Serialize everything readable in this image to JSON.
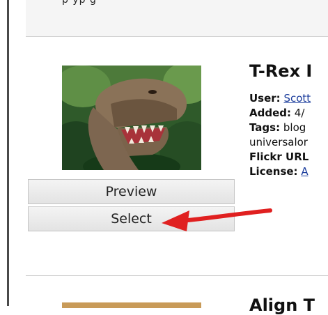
{
  "header": {
    "partial_text": "p  yp g  "
  },
  "result": {
    "title": "T-Rex I",
    "user_label": "User:",
    "user_value": "Scott",
    "added_label": "Added:",
    "added_value": "4/",
    "tags_label": "Tags:",
    "tags_value": "blog",
    "tags_value_2": "universalor",
    "flickr_label": "Flickr URL",
    "license_label": "License:",
    "license_value": "A"
  },
  "buttons": {
    "preview": "Preview",
    "select": "Select"
  },
  "next_result": {
    "title": "Align T"
  },
  "colors": {
    "arrow": "#e02020",
    "link": "#1a3c9c"
  }
}
